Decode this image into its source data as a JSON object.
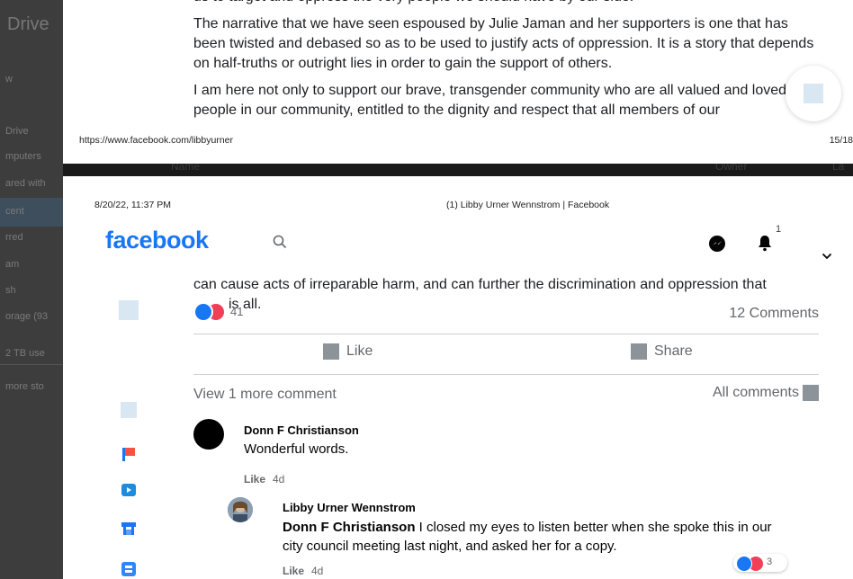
{
  "background": {
    "drive_title": "Drive",
    "sidebar_items": [
      "w",
      "Drive",
      "mputers",
      "ared with",
      "cent",
      "rred",
      "am",
      "sh",
      "orage (93",
      "2 TB use",
      "more sto"
    ],
    "list_headers": [
      "Name",
      "Owner",
      "La"
    ]
  },
  "page1": {
    "top_cut_text": "us to target and oppress the very people we should have by our side.",
    "paragraph1": "The narrative that we have seen espoused by Julie Jaman and her supporters is one that has been twisted and debased so as to be used to justify acts of oppression. It is a story that depends on half-truths or outright lies in order to gain the support of others.",
    "paragraph2": "I am here not only to support our brave, transgender community who are all valued and loved people in our community, entitled to the dignity and respect that all members of our",
    "footer_url": "https://www.facebook.com/libbyurner",
    "footer_page": "15/18"
  },
  "page2": {
    "header_date": "8/20/22, 11:37 PM",
    "header_title": "(1) Libby Urner Wennstrom | Facebook",
    "logo": "facebook",
    "notification_count": "1",
    "post": {
      "text_line": "can cause acts of irreparable harm, and can further the discrimination and oppression that",
      "text_tail": "is all.",
      "reaction_count": "41",
      "comments_count": "12 Comments",
      "like_label": "Like",
      "share_label": "Share",
      "view_more": "View 1 more comment",
      "all_comments": "All comments"
    },
    "comments": [
      {
        "author": "Donn F Christianson",
        "text": "Wonderful words.",
        "like_label": "Like",
        "time": "4d"
      },
      {
        "author": "Libby Urner Wennstrom",
        "mention": "Donn F Christianson",
        "text": " I closed my eyes to listen better when she spoke this in our city council meeting last night, and asked her for a copy.",
        "like_label": "Like",
        "time": "4d",
        "reaction_count": "3"
      }
    ]
  },
  "colors": {
    "facebook_blue": "#1877f2",
    "love_red": "#f33e58",
    "secondary_text": "#65676b"
  }
}
